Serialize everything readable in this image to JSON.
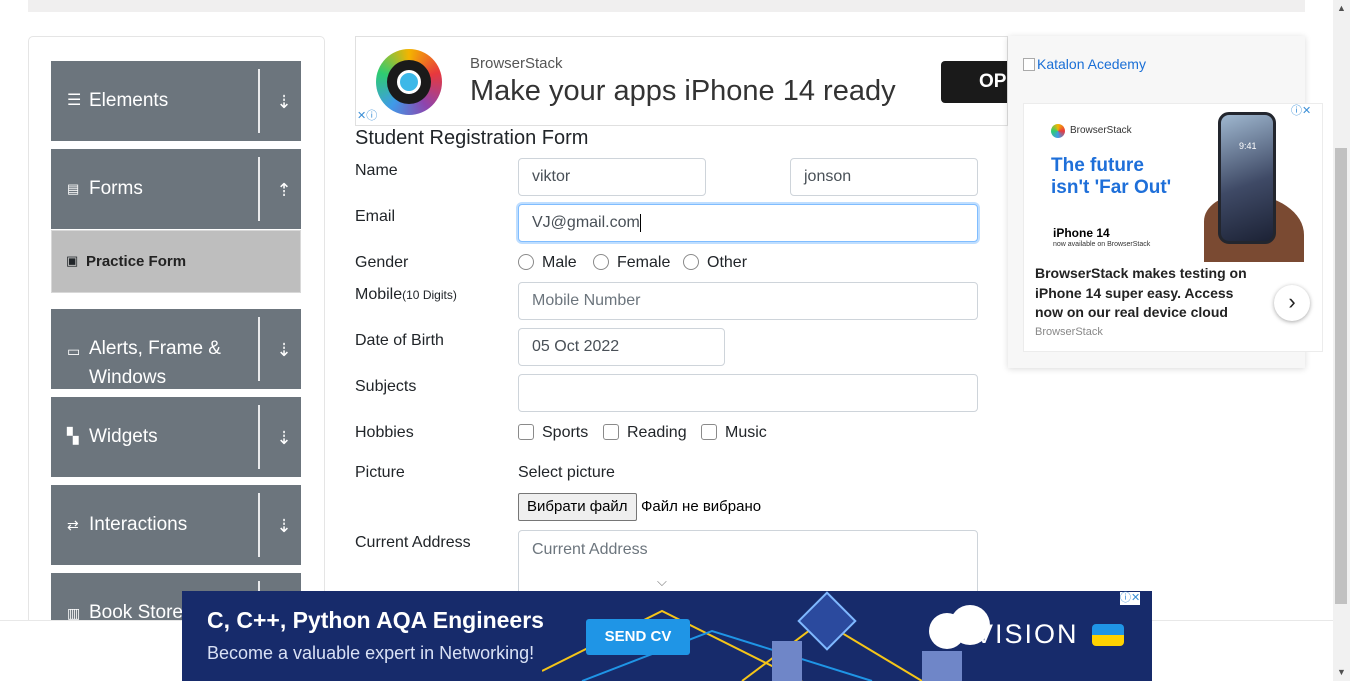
{
  "sidebar": {
    "groups": [
      {
        "title": "Elements",
        "icon": "hamburger-icon",
        "arrow": "⇣"
      },
      {
        "title": "Forms",
        "icon": "document-icon",
        "arrow": "⇡"
      },
      {
        "title": "Alerts, Frame & Windows",
        "icon": "window-icon",
        "arrow": "⇣"
      },
      {
        "title": "Widgets",
        "icon": "widgets-icon",
        "arrow": "⇣"
      },
      {
        "title": "Interactions",
        "icon": "interactions-icon",
        "arrow": "⇣"
      },
      {
        "title": "Book Store",
        "icon": "books-icon",
        "arrow": "⇣"
      }
    ],
    "active_item": "Practice Form"
  },
  "ads": {
    "top": {
      "brand": "BrowserStack",
      "headline": "Make your apps iPhone 14 ready",
      "cta": "OPEN"
    },
    "right": {
      "broken_image_alt": "Katalon Acedemy",
      "mini_brand": "BrowserStack",
      "headline_line1": "The future",
      "headline_line2": "isn't 'Far Out'",
      "iphone_title": "iPhone 14",
      "iphone_sub": "now available on BrowserStack",
      "clock": "9:41",
      "body": "BrowserStack makes testing on iPhone 14 super easy. Access now on our real device cloud",
      "source": "BrowserStack"
    },
    "bottom": {
      "title": "C, C++, Python AQA Engineers",
      "subtitle": "Become a valuable expert in Networking!",
      "cta": "SEND CV",
      "brand": "PLVISION"
    }
  },
  "form": {
    "title": "Student Registration Form",
    "labels": {
      "name": "Name",
      "email": "Email",
      "gender": "Gender",
      "mobile": "Mobile",
      "mobile_hint": "(10 Digits)",
      "dob": "Date of Birth",
      "subjects": "Subjects",
      "hobbies": "Hobbies",
      "picture": "Picture",
      "address": "Current Address"
    },
    "first_name": "viktor",
    "last_name": "jonson",
    "email": "VJ@gmail.com",
    "gender_options": [
      "Male",
      "Female",
      "Other"
    ],
    "mobile_placeholder": "Mobile Number",
    "dob": "05 Oct 2022",
    "subjects": "",
    "hobby_options": [
      "Sports",
      "Reading",
      "Music"
    ],
    "picture_label": "Select picture",
    "file_button": "Вибрати файл",
    "file_status": "Файл не вибрано",
    "address_placeholder": "Current Address"
  },
  "colors": {
    "sidebar_group": "#6c757d",
    "active_item": "#bebebe",
    "ad_bottom_bg": "#172b6b",
    "cta_blue": "#1f95e6"
  }
}
